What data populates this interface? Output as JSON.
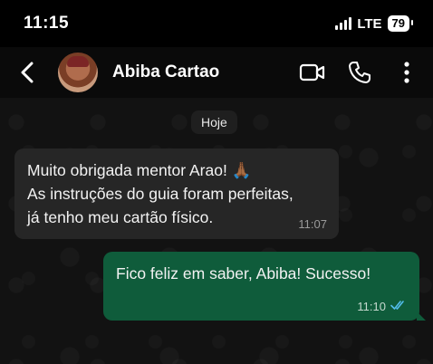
{
  "status": {
    "time": "11:15",
    "network": "LTE",
    "battery": "79"
  },
  "header": {
    "contact_name": "Abiba Cartao"
  },
  "chat": {
    "date_label": "Hoje",
    "incoming": {
      "lines": [
        "Muito obrigada mentor Arao! 🙏🏾",
        "As instruções do guia foram perfeitas,",
        "já tenho meu cartão físico."
      ],
      "time": "11:07"
    },
    "outgoing": {
      "text": "Fico feliz em saber, Abiba! Sucesso!",
      "time": "11:10",
      "read_color": "#53bdeb"
    }
  },
  "icons": [
    "back-arrow-icon",
    "video-call-icon",
    "phone-icon",
    "more-options-icon",
    "double-check-icon"
  ]
}
